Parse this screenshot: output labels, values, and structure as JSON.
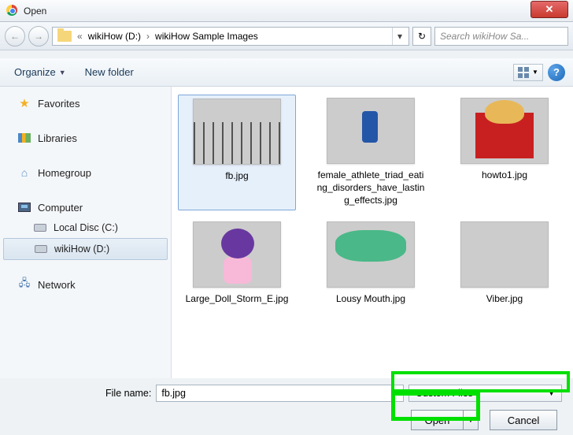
{
  "window": {
    "title": "Open"
  },
  "nav": {
    "path_prefix": "«",
    "path_parts": [
      "wikiHow (D:)",
      "wikiHow Sample Images"
    ],
    "search_placeholder": "Search wikiHow Sa..."
  },
  "toolbar": {
    "organize": "Organize",
    "newfolder": "New folder"
  },
  "sidebar": {
    "favorites": "Favorites",
    "libraries": "Libraries",
    "homegroup": "Homegroup",
    "computer": "Computer",
    "drive_c": "Local Disc (C:)",
    "drive_d": "wikiHow (D:)",
    "network": "Network"
  },
  "files": {
    "f0": "fb.jpg",
    "f1": "female_athlete_triad_eating_disorders_have_lasting_effects.jpg",
    "f2": "howto1.jpg",
    "f3": "Large_Doll_Storm_E.jpg",
    "f4": "Lousy Mouth.jpg",
    "f5": "Viber.jpg"
  },
  "bottom": {
    "filename_label": "File name:",
    "filename_value": "fb.jpg",
    "filter": "Custom Files",
    "open": "Open",
    "cancel": "Cancel"
  }
}
